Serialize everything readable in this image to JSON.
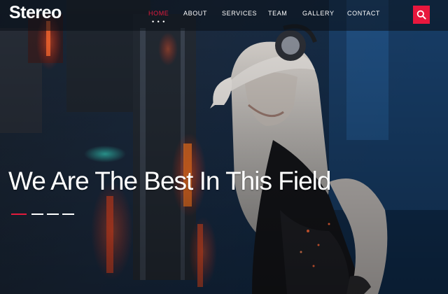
{
  "brand": {
    "name": "Stereo"
  },
  "nav": {
    "items": [
      {
        "label": "HOME",
        "active": true
      },
      {
        "label": "ABOUT",
        "active": false
      },
      {
        "label": "SERVICES",
        "active": false
      },
      {
        "label": "TEAM",
        "active": false
      },
      {
        "label": "GALLERY",
        "active": false
      },
      {
        "label": "CONTACT",
        "active": false
      }
    ],
    "active_indicator": "• • •"
  },
  "search": {
    "icon": "search-icon"
  },
  "hero": {
    "headline": "We Are The Best In This Field",
    "image": "dj-with-headphones"
  },
  "colors": {
    "accent": "#e8173d",
    "text": "#ffffff",
    "background": "#0d1622"
  }
}
